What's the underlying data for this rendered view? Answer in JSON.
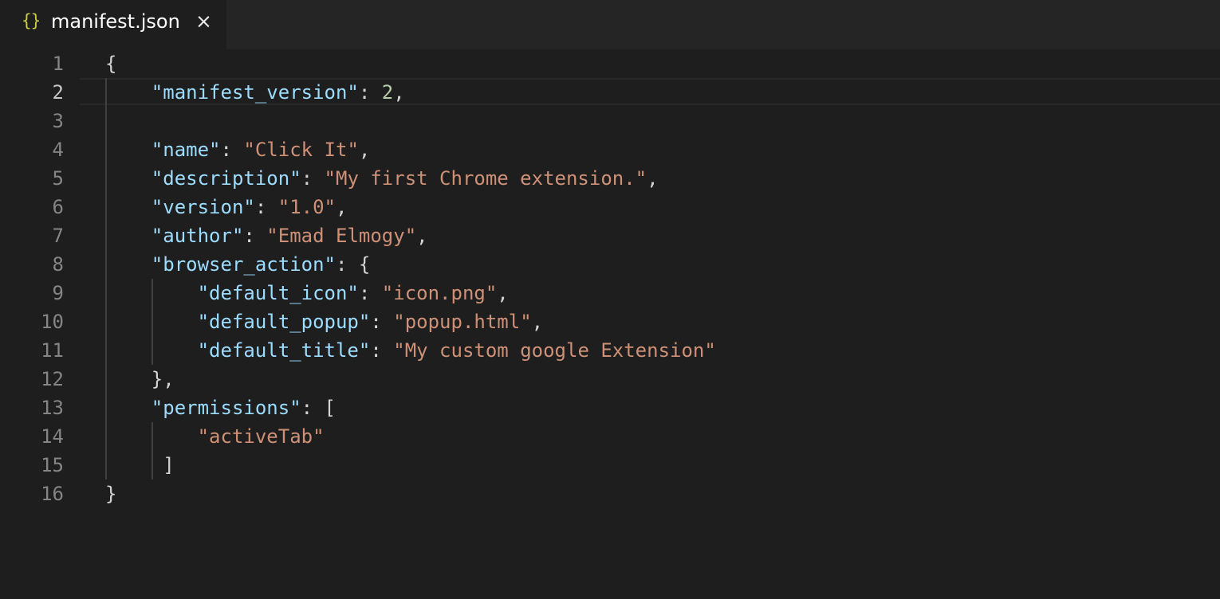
{
  "tab": {
    "icon_glyph": "{}",
    "title": "manifest.json",
    "close_glyph": "×"
  },
  "colors": {
    "background": "#1e1e1e",
    "key": "#9cdcfe",
    "string": "#ce9178",
    "number": "#b5cea8",
    "punctuation": "#d4d4d4",
    "line_number": "#858585",
    "json_icon": "#cbcb41"
  },
  "editor": {
    "active_line": 2,
    "lines": [
      {
        "number": "1",
        "indent": "",
        "tokens": [
          {
            "t": "punc",
            "v": "{"
          }
        ]
      },
      {
        "number": "2",
        "indent": "    ",
        "tokens": [
          {
            "t": "key",
            "v": "\"manifest_version\""
          },
          {
            "t": "punc",
            "v": ": "
          },
          {
            "t": "num",
            "v": "2"
          },
          {
            "t": "punc",
            "v": ","
          }
        ]
      },
      {
        "number": "3",
        "indent": "",
        "tokens": []
      },
      {
        "number": "4",
        "indent": "    ",
        "tokens": [
          {
            "t": "key",
            "v": "\"name\""
          },
          {
            "t": "punc",
            "v": ": "
          },
          {
            "t": "str",
            "v": "\"Click It\""
          },
          {
            "t": "punc",
            "v": ","
          }
        ]
      },
      {
        "number": "5",
        "indent": "    ",
        "tokens": [
          {
            "t": "key",
            "v": "\"description\""
          },
          {
            "t": "punc",
            "v": ": "
          },
          {
            "t": "str",
            "v": "\"My first Chrome extension.\""
          },
          {
            "t": "punc",
            "v": ","
          }
        ]
      },
      {
        "number": "6",
        "indent": "    ",
        "tokens": [
          {
            "t": "key",
            "v": "\"version\""
          },
          {
            "t": "punc",
            "v": ": "
          },
          {
            "t": "str",
            "v": "\"1.0\""
          },
          {
            "t": "punc",
            "v": ","
          }
        ]
      },
      {
        "number": "7",
        "indent": "    ",
        "tokens": [
          {
            "t": "key",
            "v": "\"author\""
          },
          {
            "t": "punc",
            "v": ": "
          },
          {
            "t": "str",
            "v": "\"Emad Elmogy\""
          },
          {
            "t": "punc",
            "v": ","
          }
        ]
      },
      {
        "number": "8",
        "indent": "    ",
        "tokens": [
          {
            "t": "key",
            "v": "\"browser_action\""
          },
          {
            "t": "punc",
            "v": ": {"
          }
        ]
      },
      {
        "number": "9",
        "indent": "        ",
        "tokens": [
          {
            "t": "key",
            "v": "\"default_icon\""
          },
          {
            "t": "punc",
            "v": ": "
          },
          {
            "t": "str",
            "v": "\"icon.png\""
          },
          {
            "t": "punc",
            "v": ","
          }
        ]
      },
      {
        "number": "10",
        "indent": "        ",
        "tokens": [
          {
            "t": "key",
            "v": "\"default_popup\""
          },
          {
            "t": "punc",
            "v": ": "
          },
          {
            "t": "str",
            "v": "\"popup.html\""
          },
          {
            "t": "punc",
            "v": ","
          }
        ]
      },
      {
        "number": "11",
        "indent": "        ",
        "tokens": [
          {
            "t": "key",
            "v": "\"default_title\""
          },
          {
            "t": "punc",
            "v": ": "
          },
          {
            "t": "str",
            "v": "\"My custom google Extension\""
          }
        ]
      },
      {
        "number": "12",
        "indent": "    ",
        "tokens": [
          {
            "t": "punc",
            "v": "},"
          }
        ]
      },
      {
        "number": "13",
        "indent": "    ",
        "tokens": [
          {
            "t": "key",
            "v": "\"permissions\""
          },
          {
            "t": "punc",
            "v": ": ["
          }
        ]
      },
      {
        "number": "14",
        "indent": "        ",
        "tokens": [
          {
            "t": "str",
            "v": "\"activeTab\""
          }
        ]
      },
      {
        "number": "15",
        "indent": "     ",
        "tokens": [
          {
            "t": "punc",
            "v": "]"
          }
        ]
      },
      {
        "number": "16",
        "indent": "",
        "tokens": [
          {
            "t": "punc",
            "v": "}"
          }
        ]
      }
    ]
  }
}
